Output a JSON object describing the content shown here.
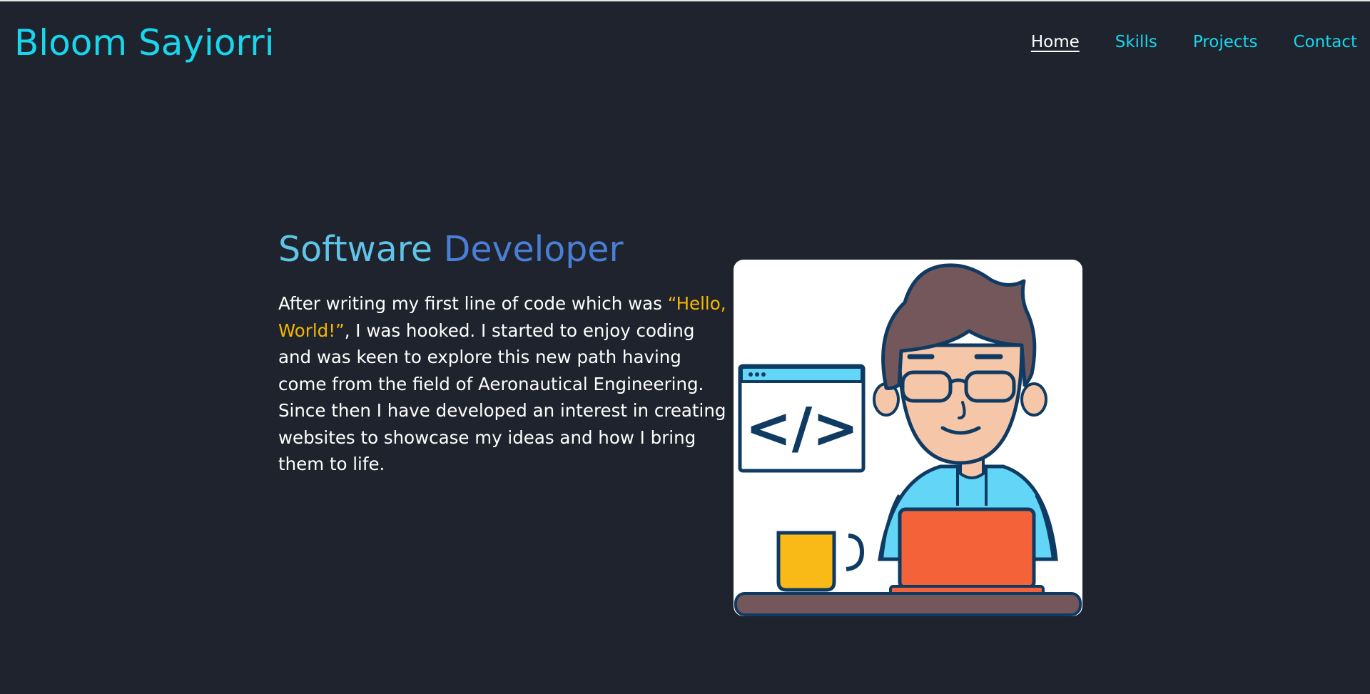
{
  "header": {
    "brand": "Bloom Sayiorri",
    "nav": [
      {
        "label": "Home",
        "active": true
      },
      {
        "label": "Skills",
        "active": false
      },
      {
        "label": "Projects",
        "active": false
      },
      {
        "label": "Contact",
        "active": false
      }
    ]
  },
  "hero": {
    "title_part1": "Software",
    "title_part2": "Developer",
    "text_before": "After writing my first line of code which was ",
    "text_highlight": "“Hello, World!”",
    "text_after": ", I was hooked. I started to enjoy coding and was keen to explore this new path having come from the field of Aeronautical Engineering. Since then I have developed an interest in creating websites to showcase my ideas and how I bring them to life.",
    "illustration": {
      "code_symbol": "</>",
      "icon": "developer-with-laptop-illustration"
    }
  },
  "colors": {
    "background": "#1f232d",
    "accent": "#18d6ec",
    "title_light": "#5fc4e8",
    "title_dark": "#4a7fd6",
    "highlight": "#f5b800",
    "text": "#ffffff"
  }
}
